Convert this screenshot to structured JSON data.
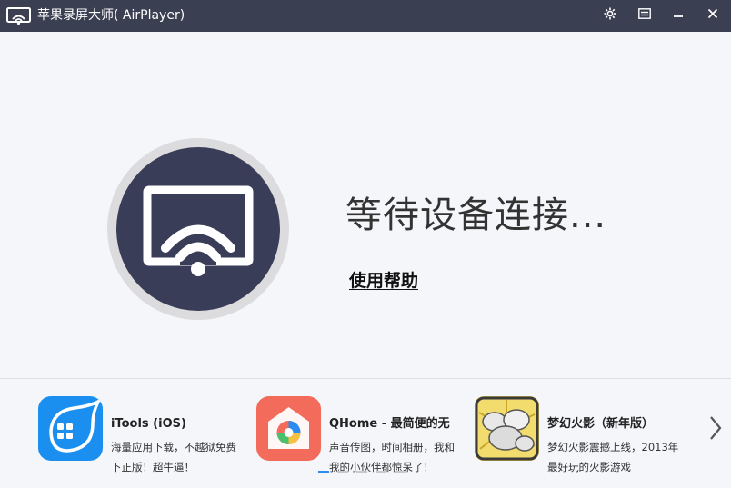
{
  "window": {
    "title": "苹果录屏大师( AirPlayer)",
    "controls": [
      "settings-icon",
      "menu-icon",
      "minimize-icon",
      "close-icon"
    ]
  },
  "main": {
    "status_text": "等待设备连接...",
    "help_link": "使用帮助",
    "illustration_icon": "airplay-wifi-icon"
  },
  "recommended_apps": [
    {
      "name": "iTools (iOS)",
      "desc_line1": "海量应用下载，不越狱免费",
      "desc_line2": "下正版！超牛逼！",
      "icon": "itools-icon",
      "color": "#1a8ff0"
    },
    {
      "name": "QHome - 最简便的无",
      "desc_line1": "声音传图，时间相册，我和",
      "desc_line2": "我的小伙伴都惊呆了！",
      "icon": "qhome-icon",
      "color": "#f26b5b"
    },
    {
      "name": "梦幻火影（新年版）",
      "desc_line1": "梦幻火影震撼上线，2013年",
      "desc_line2": "最好玩的火影游戏",
      "icon": "game-icon",
      "color": "#e7c84a"
    }
  ],
  "carousel": {
    "page_count": 5,
    "active_page": 1,
    "next_icon": "chevron-right-icon"
  },
  "colors": {
    "titlebar": "#3b3f52",
    "circle_dark": "#3a3d58",
    "accent": "#2d8cf0"
  }
}
